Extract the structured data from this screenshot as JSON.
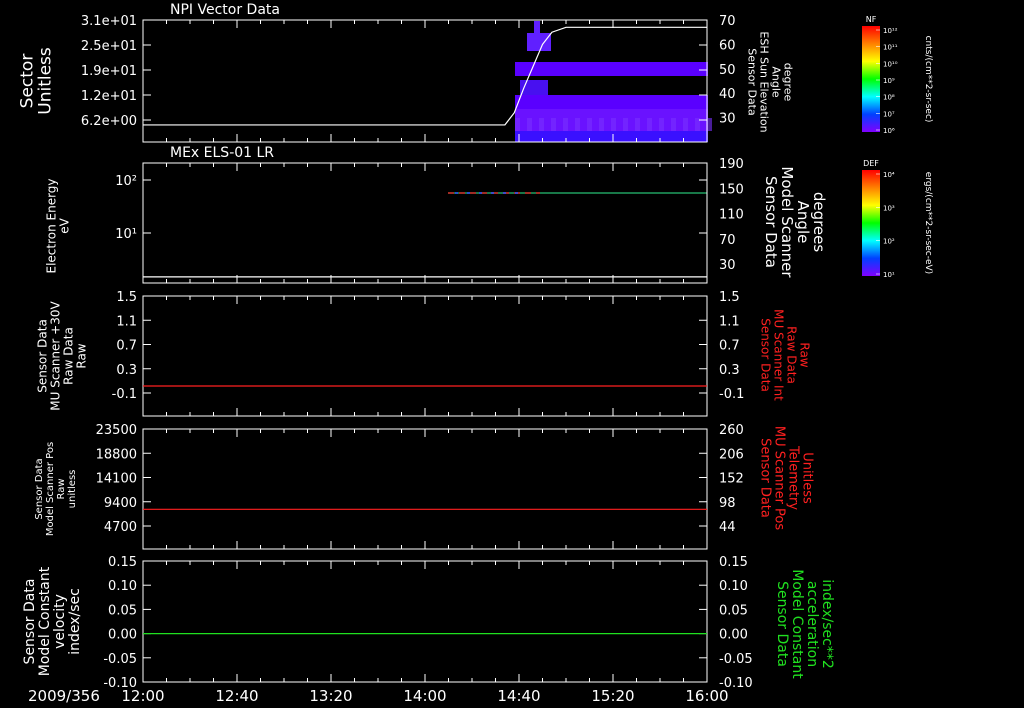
{
  "chart_data": [
    {
      "type": "heatmap",
      "title": "NPI Vector Data",
      "ylabel": [
        "Sector",
        "Unitless"
      ],
      "yticks": [
        "3.1e+01",
        "2.5e+01",
        "1.9e+01",
        "1.2e+01",
        "6.2e+00"
      ],
      "y2label": [
        "Sensor Data",
        "ESH Sun Elevation",
        "Angle",
        "degree"
      ],
      "y2ticks": [
        "70",
        "60",
        "50",
        "40",
        "30"
      ],
      "y2lim": [
        20,
        70
      ],
      "line_color": "#ffffff",
      "line": {
        "x": [
          "12:00",
          "14:34",
          "14:38",
          "14:42",
          "14:46",
          "14:50",
          "14:54",
          "15:00",
          "16:00"
        ],
        "y": [
          27,
          27,
          32,
          42,
          51,
          60,
          65,
          67,
          67
        ]
      },
      "colorbar": {
        "label": "NF",
        "unit": "cnts/(cm**2-sr-sec)",
        "ticks": [
          "10¹²",
          "10¹¹",
          "10¹⁰",
          "10⁹",
          "10⁸",
          "10⁷",
          "10⁶"
        ]
      }
    },
    {
      "type": "heatmap",
      "title": "MEx ELS-01 LR",
      "ylabel": [
        "Electron Energy",
        "eV"
      ],
      "yticks": [
        "10²",
        "10¹"
      ],
      "y2label": [
        "Sensor Data",
        "Model Scanner",
        "Angle",
        "degrees"
      ],
      "y2ticks": [
        "190",
        "150",
        "110",
        "70",
        "30"
      ],
      "y2lim": [
        0,
        190
      ],
      "line_color": "#ffffff",
      "line": {
        "x": [
          "12:00",
          "16:00"
        ],
        "y": [
          5,
          5
        ]
      },
      "colorbar": {
        "label": "DEF",
        "unit": "ergs/(cm**2-sr-sec-eV)",
        "ticks": [
          "10⁴",
          "10³",
          "10²",
          "10¹"
        ]
      }
    },
    {
      "type": "line",
      "ylabel": [
        "Sensor Data",
        "MU Scanner +30V",
        "Raw Data",
        "Raw"
      ],
      "yticks": [
        "1.5",
        "1.1",
        "0.7",
        "0.3",
        "-0.1"
      ],
      "ylim": [
        -0.5,
        1.5
      ],
      "y2label": [
        "Sensor Data",
        "MU Scanner Int",
        "Raw Data",
        "Raw"
      ],
      "y2ticks": [
        "1.5",
        "1.1",
        "0.7",
        "0.3",
        "-0.1"
      ],
      "y2_color": "#ff2020",
      "line_color": "#ff2020",
      "line": {
        "x": [
          "12:00",
          "16:00"
        ],
        "y": [
          0,
          0
        ]
      }
    },
    {
      "type": "line",
      "ylabel": [
        "Sensor Data",
        "Model Scanner Pos",
        "Raw",
        "unitless"
      ],
      "yticks": [
        "23500",
        "18800",
        "14100",
        "9400",
        "4700"
      ],
      "ylim": [
        0,
        23500
      ],
      "y2label": [
        "Sensor Data",
        "MU Scanner Pos",
        "Telemetry",
        "Unitless"
      ],
      "y2ticks": [
        "260",
        "206",
        "152",
        "98",
        "44"
      ],
      "y2_color": "#ff2020",
      "line_color": "#ff2020",
      "line": {
        "x": [
          "12:00",
          "16:00"
        ],
        "y": [
          7770,
          7770
        ]
      }
    },
    {
      "type": "line",
      "ylabel": [
        "Sensor Data",
        "Model Constant",
        "velocity",
        "index/sec"
      ],
      "yticks": [
        "0.15",
        "0.10",
        "0.05",
        "0.00",
        "-0.05",
        "-0.10"
      ],
      "ylim": [
        -0.1,
        0.15
      ],
      "y2label": [
        "Sensor Data",
        "Model Constant",
        "acceleration",
        "index/sec**2"
      ],
      "y2ticks": [
        "0.15",
        "0.10",
        "0.05",
        "0.00",
        "-0.05",
        "-0.10"
      ],
      "y2_color": "#20e020",
      "line_color": "#20e020",
      "line": {
        "x": [
          "12:00",
          "16:00"
        ],
        "y": [
          0,
          0
        ]
      }
    }
  ],
  "time_axis": {
    "date": "2009/356",
    "ticks": [
      "12:00",
      "12:40",
      "13:20",
      "14:00",
      "14:40",
      "15:20",
      "16:00"
    ]
  }
}
